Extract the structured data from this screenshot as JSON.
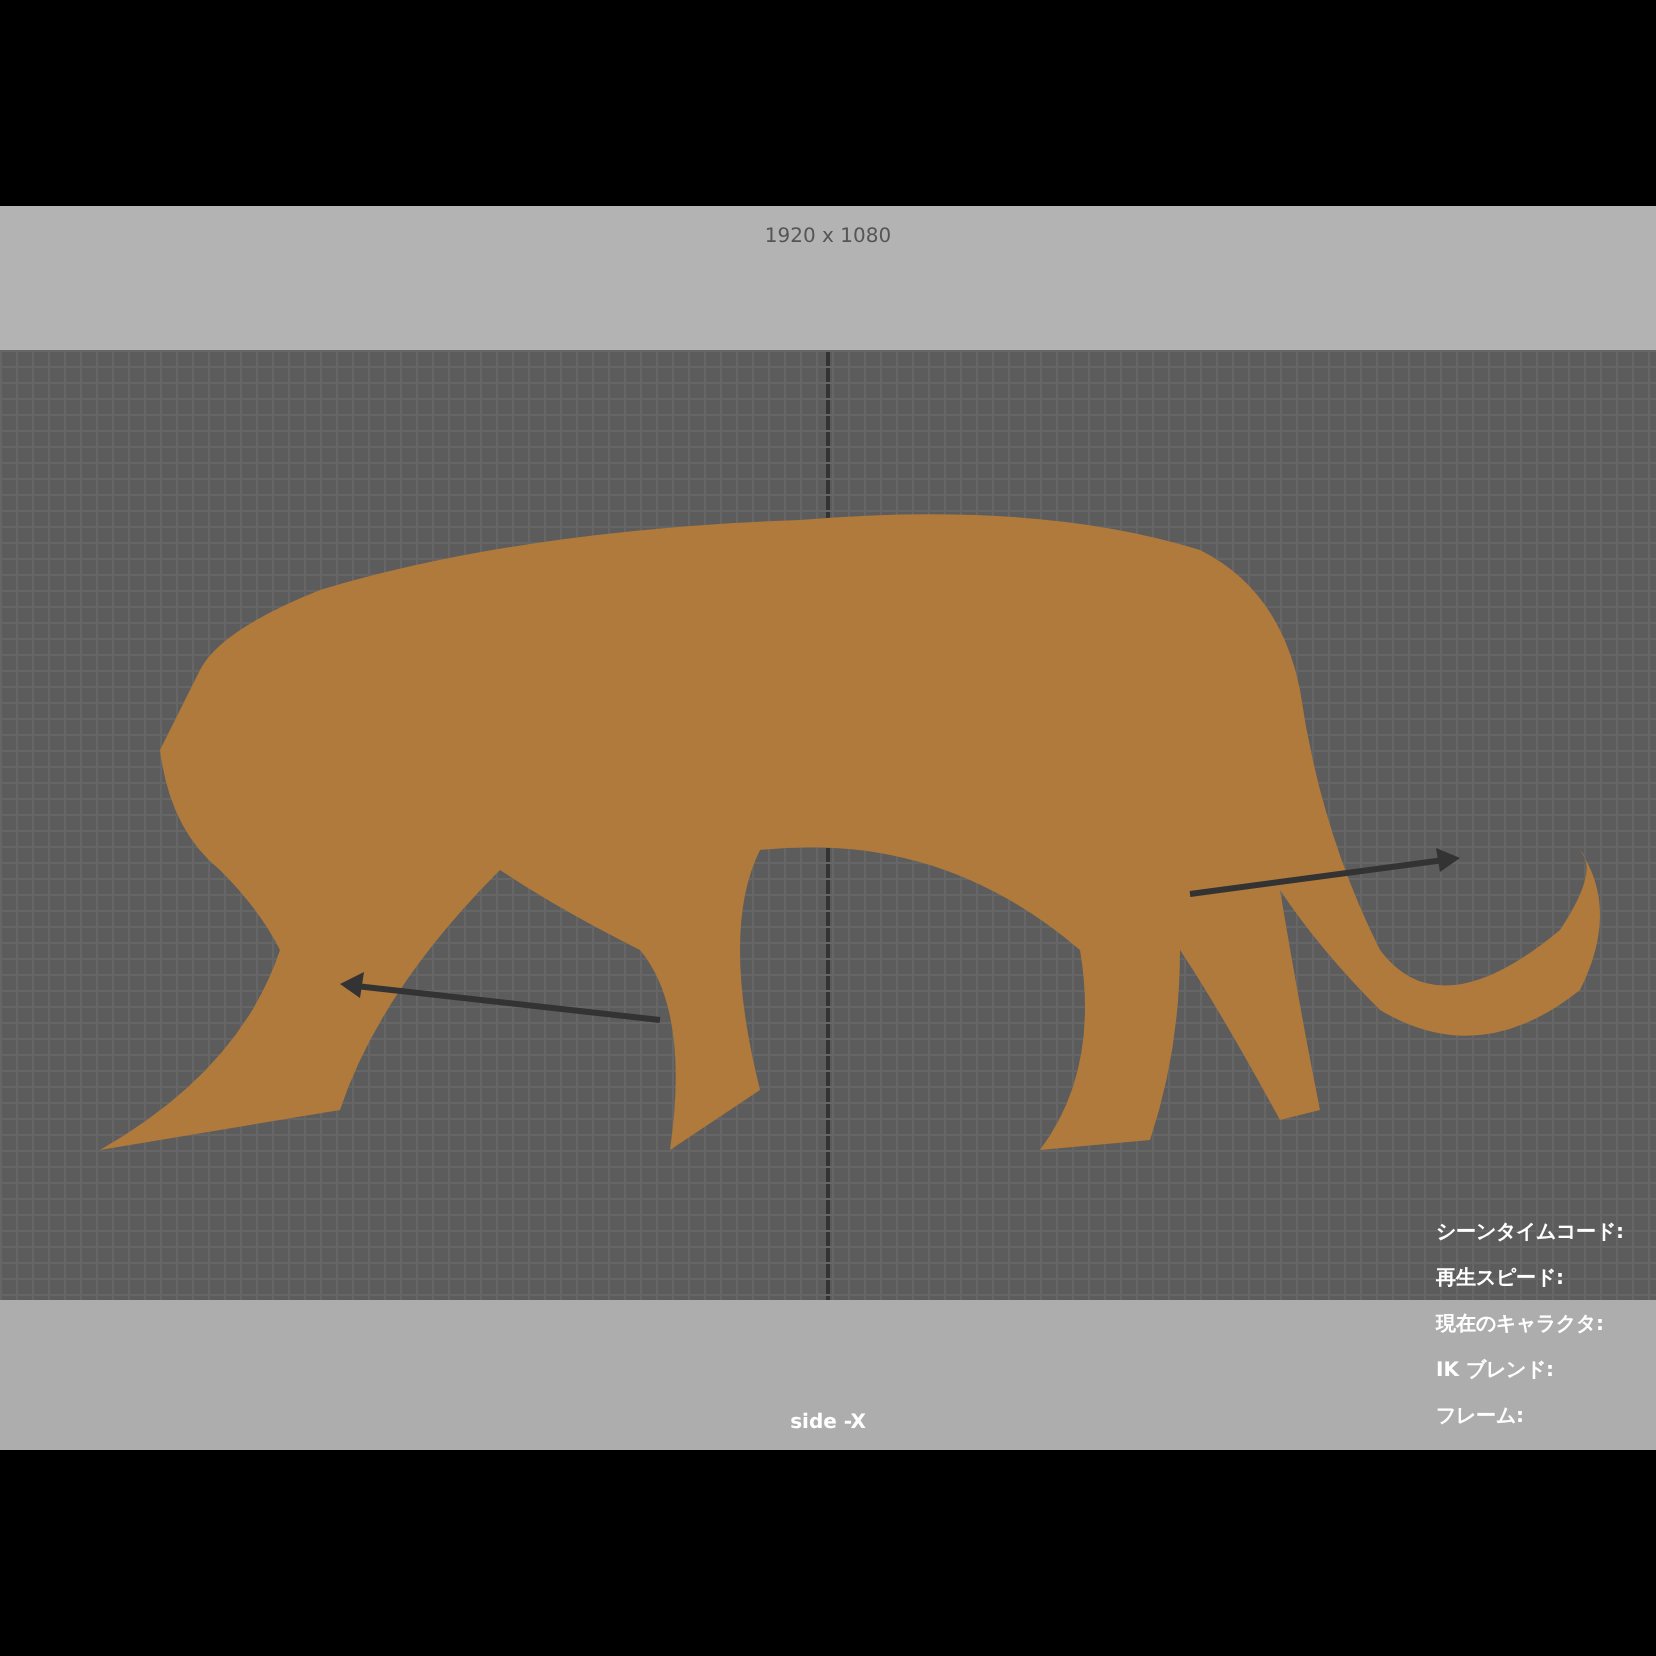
{
  "viewport": {
    "resolution": "1920 x 1080",
    "camera": "side -X",
    "hud": [
      {
        "label": "シーンタイムコード:"
      },
      {
        "label": "再生スピード:"
      },
      {
        "label": "現在のキャラクタ:"
      },
      {
        "label": "IK ブレンド:"
      },
      {
        "label": "フレーム:"
      }
    ]
  }
}
